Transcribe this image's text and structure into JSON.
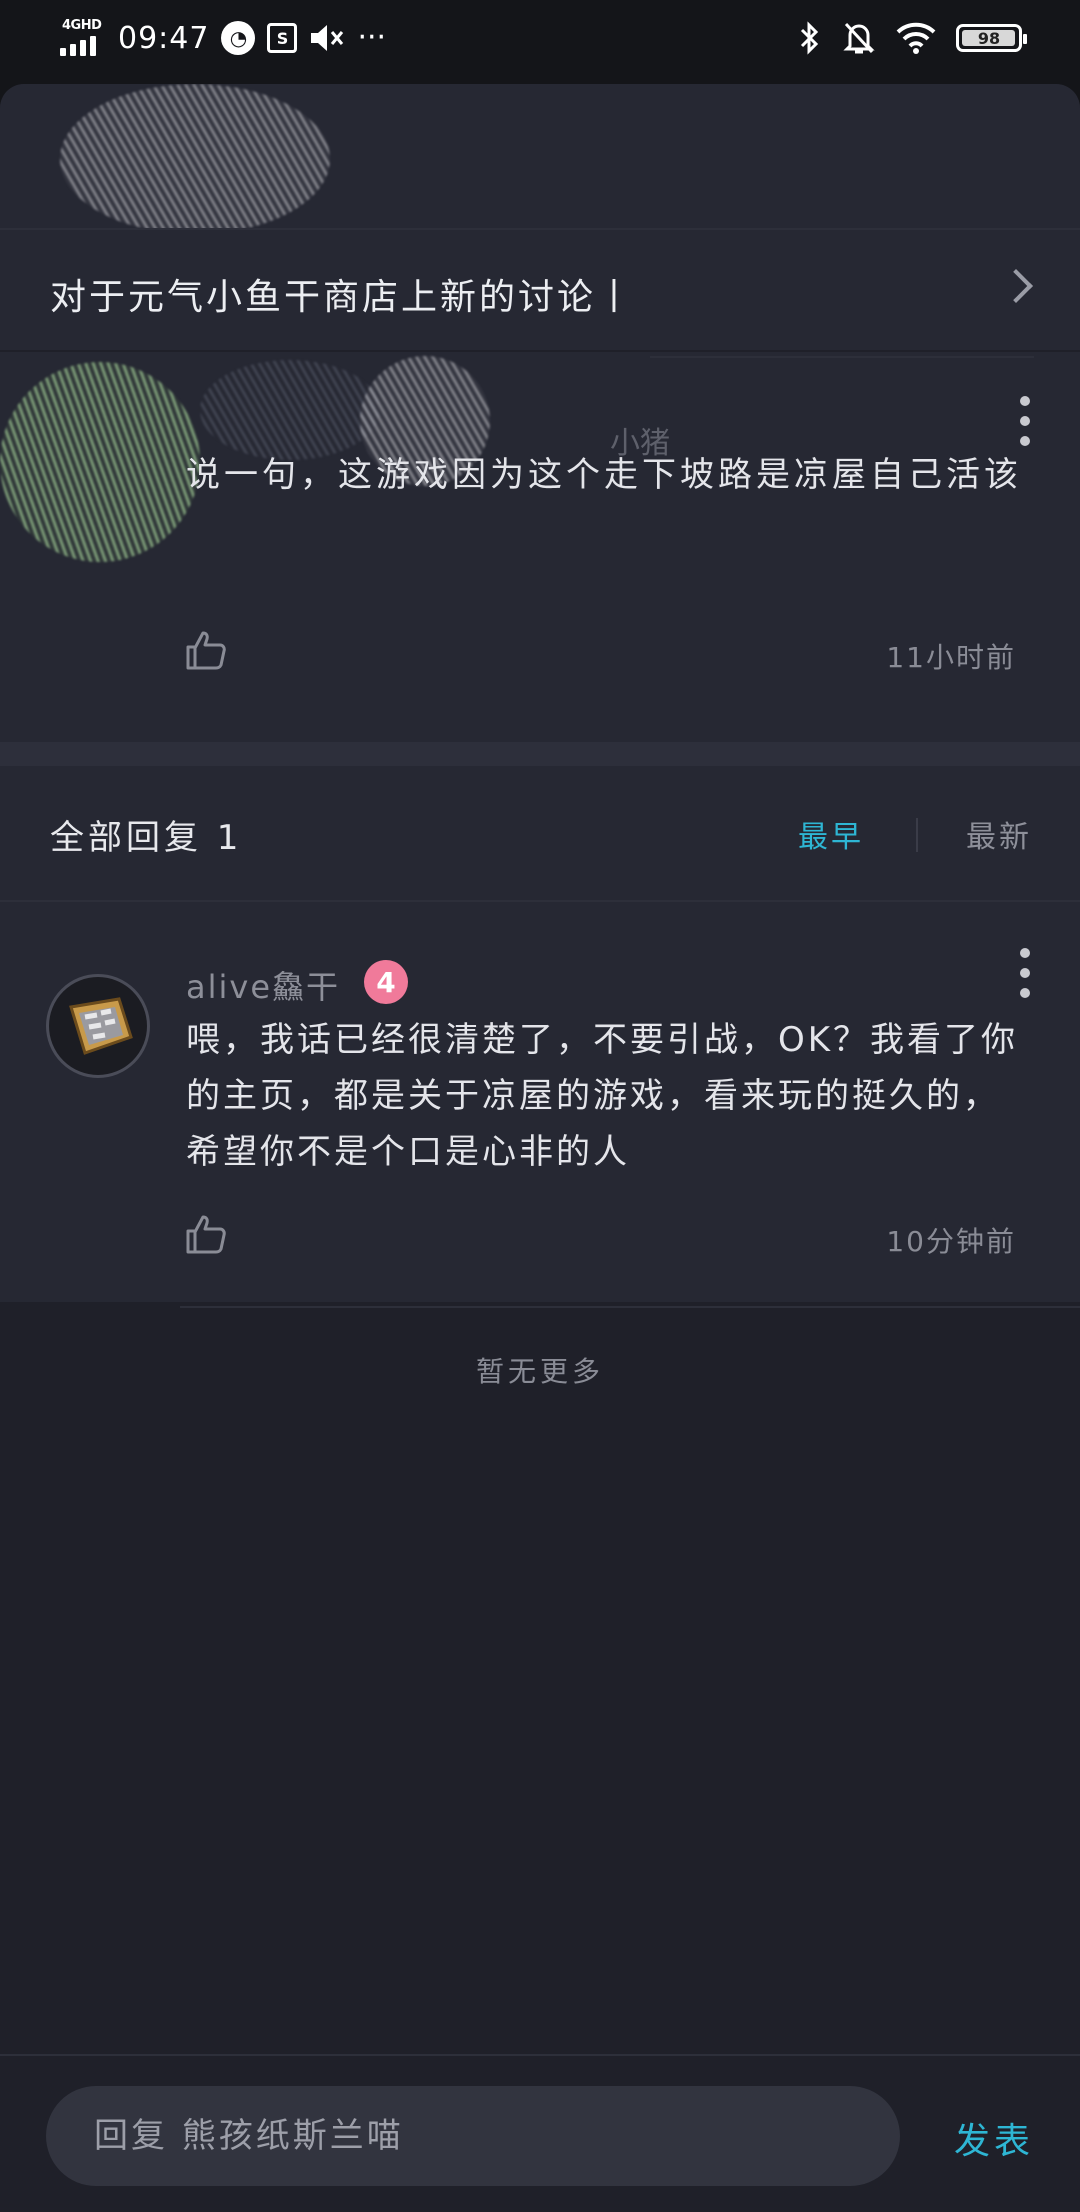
{
  "status_bar": {
    "network": "4GHD",
    "time": "09:47",
    "more": "···",
    "battery": "98",
    "battery_level": 0.98
  },
  "topic": {
    "title": "对于元气小鱼干商店上新的讨论丨"
  },
  "post": {
    "author": "小猪",
    "text": "说一句，这游戏因为这个走下坡路是凉屋自己活该",
    "time_ago": "11小时前"
  },
  "replies": {
    "title": "全部回复 1",
    "sort_earliest": "最早",
    "sort_latest": "最新",
    "items": [
      {
        "name": "alive鱻干",
        "level": "4",
        "text": "喂，我话已经很清楚了，不要引战，OK？我看了你的主页，都是关于凉屋的游戏，看来玩的挺久的，希望你不是个口是心非的人",
        "time_ago": "10分钟前"
      }
    ],
    "no_more": "暂无更多"
  },
  "composer": {
    "placeholder": "回复 熊孩纸斯兰喵",
    "send_label": "发表"
  },
  "colors": {
    "accent": "#2eb6d4",
    "level_badge": "#f07a9a",
    "card_bg": "#262833",
    "page_bg": "#1f2029"
  }
}
